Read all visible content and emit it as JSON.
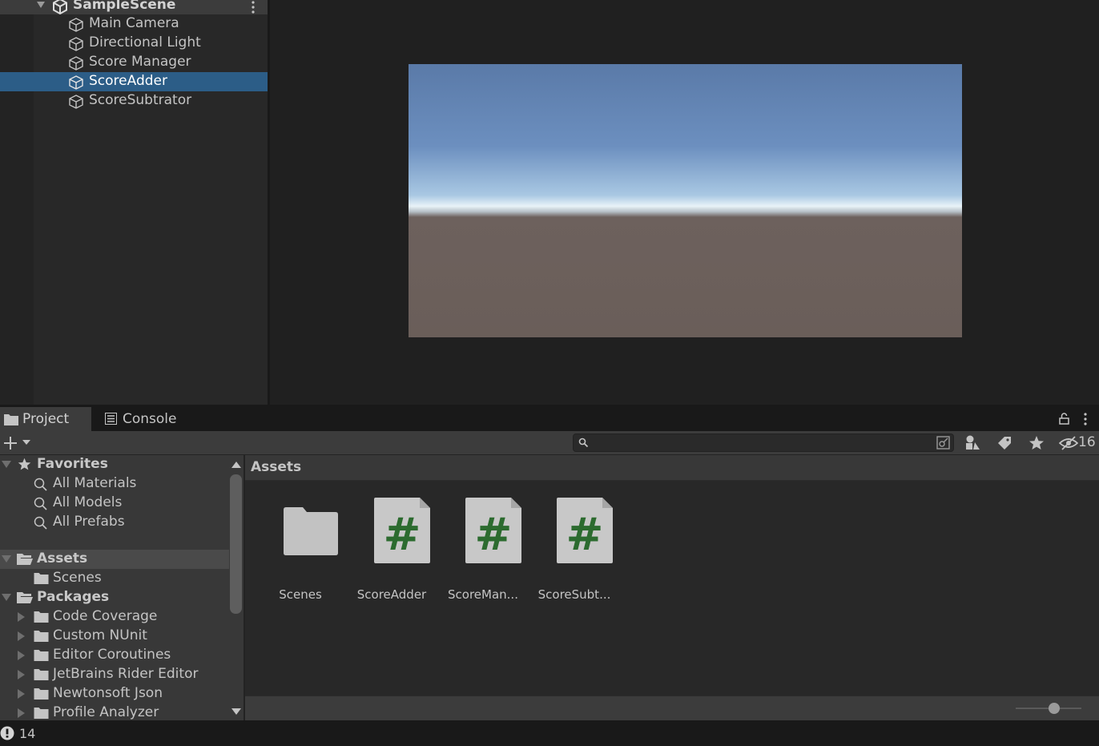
{
  "hierarchy": {
    "scene_name": "SampleScene",
    "items": [
      {
        "label": "Main Camera",
        "selected": false
      },
      {
        "label": "Directional Light",
        "selected": false
      },
      {
        "label": "Score Manager",
        "selected": false
      },
      {
        "label": "ScoreAdder",
        "selected": true
      },
      {
        "label": "ScoreSubtrator",
        "selected": false
      }
    ],
    "icons": {
      "scene": "unity-logo-icon",
      "menu": "kebab-menu-icon",
      "object": "cube-icon"
    }
  },
  "bottom_tabs": [
    {
      "label": "Project",
      "icon": "folder-icon",
      "active": true
    },
    {
      "label": "Console",
      "icon": "console-icon",
      "active": false
    }
  ],
  "toolbar": {
    "search_placeholder": "",
    "hidden_count": "16"
  },
  "tree": {
    "favorites_label": "Favorites",
    "favorites": [
      "All Materials",
      "All Models",
      "All Prefabs"
    ],
    "assets_label": "Assets",
    "assets_children": [
      "Scenes"
    ],
    "packages_label": "Packages",
    "packages": [
      "Code Coverage",
      "Custom NUnit",
      "Editor Coroutines",
      "JetBrains Rider Editor",
      "Newtonsoft Json",
      "Profile Analyzer"
    ]
  },
  "assets_panel": {
    "breadcrumb": "Assets",
    "items": [
      {
        "name": "Scenes",
        "kind": "folder"
      },
      {
        "name": "ScoreAdder",
        "kind": "script"
      },
      {
        "name": "ScoreMan...",
        "kind": "script"
      },
      {
        "name": "ScoreSubt...",
        "kind": "script"
      }
    ],
    "zoom_level": 0.58
  },
  "status": {
    "warning_count": "14"
  },
  "colors": {
    "selection": "#2c5d87",
    "script_hash": "#2c6b2f",
    "panel": "#282828",
    "header": "#3c3c3c"
  }
}
